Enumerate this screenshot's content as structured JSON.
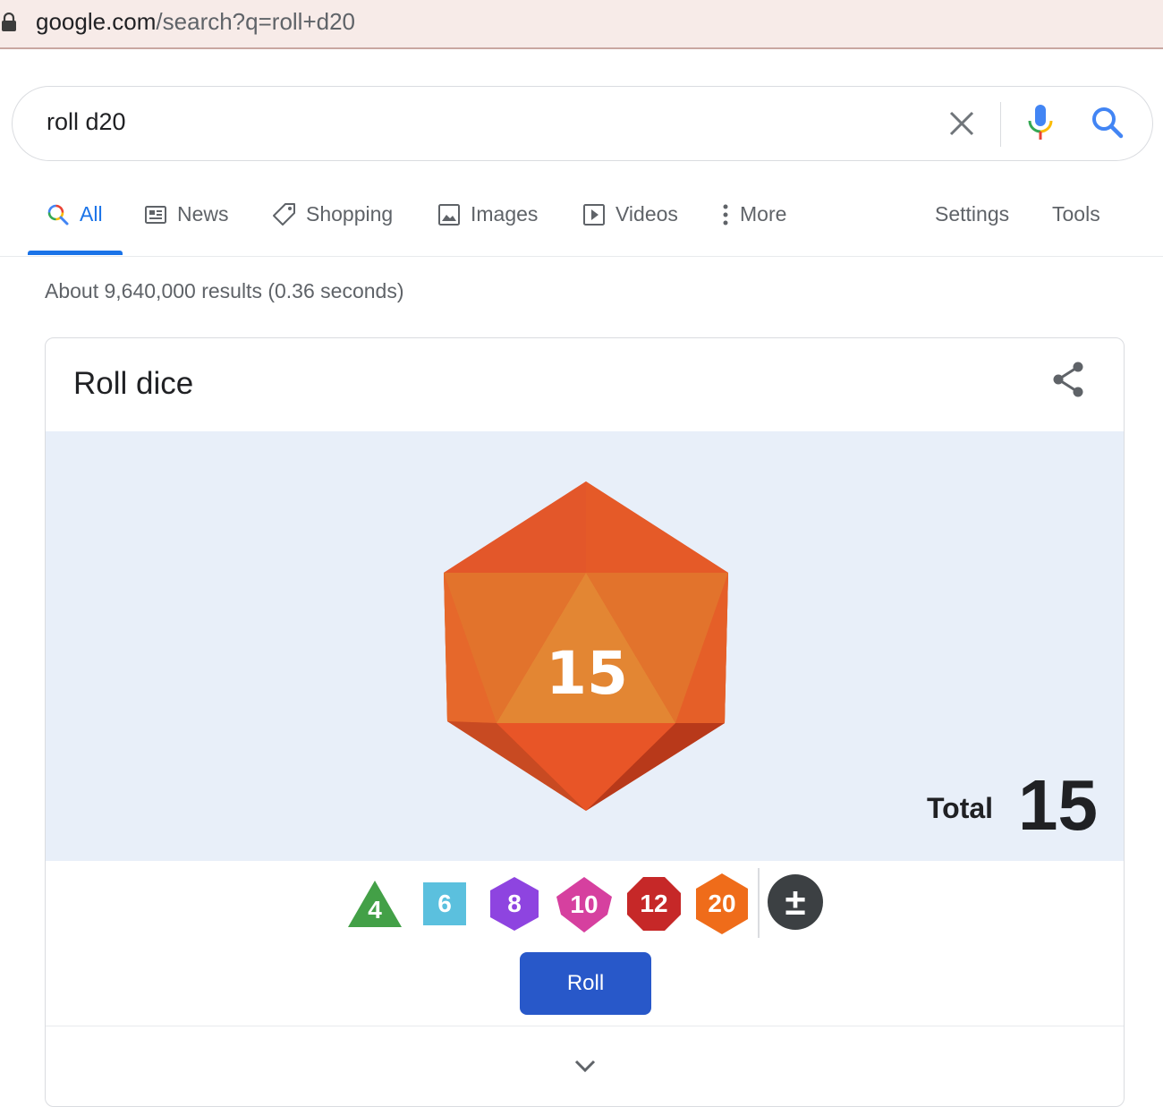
{
  "browser": {
    "url_host": "google.com",
    "url_rest": "/search?q=roll+d20"
  },
  "search": {
    "query": "roll d20"
  },
  "tabs": [
    {
      "label": "All",
      "icon": "search-icon",
      "active": true
    },
    {
      "label": "News",
      "icon": "news-icon"
    },
    {
      "label": "Shopping",
      "icon": "tag-icon"
    },
    {
      "label": "Images",
      "icon": "image-icon"
    },
    {
      "label": "Videos",
      "icon": "play-icon"
    },
    {
      "label": "More",
      "icon": "more-vert-icon"
    },
    {
      "label": "Settings"
    },
    {
      "label": "Tools"
    }
  ],
  "results_stats": "About 9,640,000 results (0.36 seconds)",
  "card": {
    "title": "Roll dice",
    "rolled_value": "15",
    "total_label": "Total",
    "total_value": "15",
    "dice_options": [
      {
        "label": "4",
        "color": "#43a047"
      },
      {
        "label": "6",
        "color": "#5bc0de"
      },
      {
        "label": "8",
        "color": "#8e44e0"
      },
      {
        "label": "10",
        "color": "#d6409f"
      },
      {
        "label": "12",
        "color": "#c62828"
      },
      {
        "label": "20",
        "color": "#ef6c1a"
      }
    ],
    "modifier_symbol": "±",
    "roll_button": "Roll"
  },
  "colors": {
    "accent": "#1a73e8",
    "roll_button": "#2858c9",
    "dice_panel_bg": "#e8eff9",
    "d20_face": "#e85a26"
  }
}
